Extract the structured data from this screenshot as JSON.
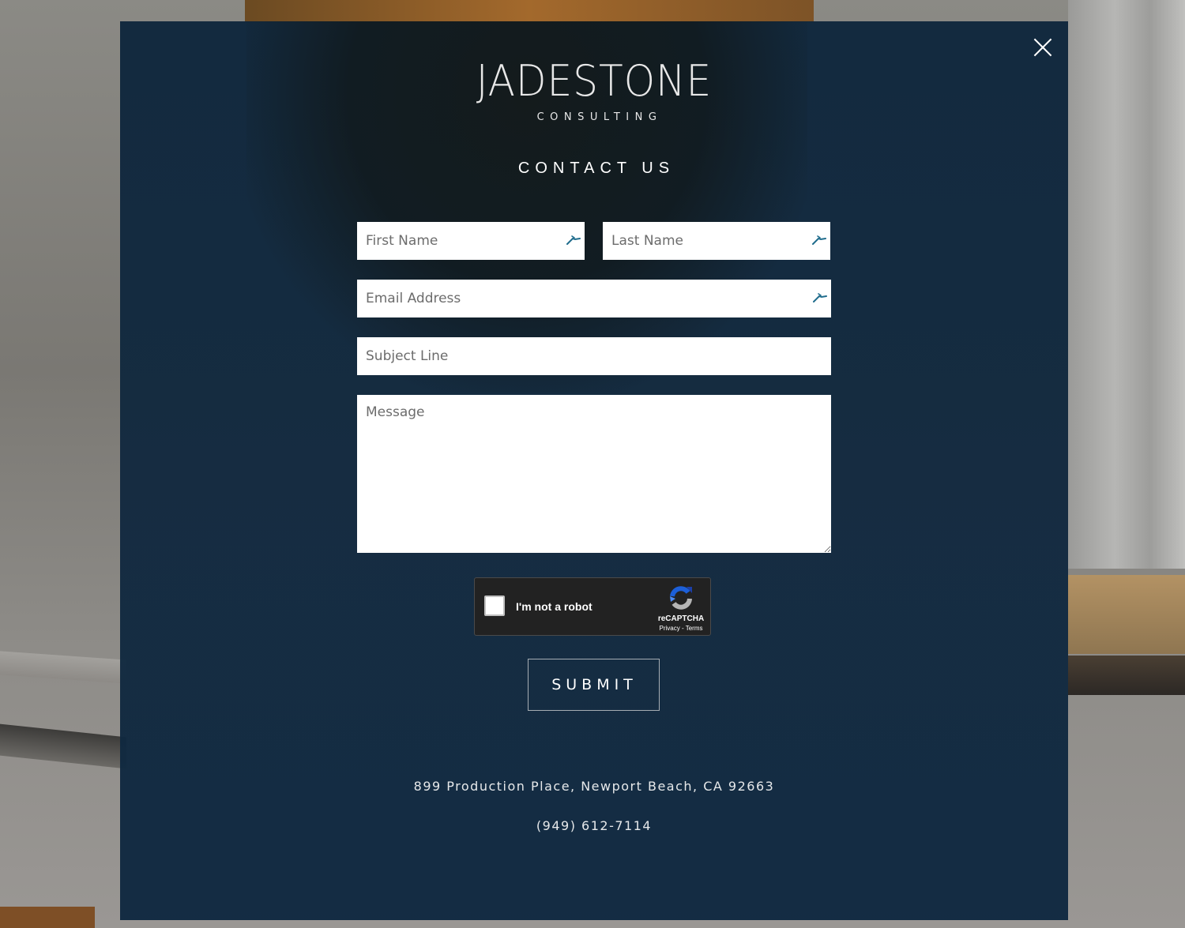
{
  "modal": {
    "close_icon": "close-icon",
    "logo": {
      "name": "JADESTONE",
      "tagline": "CONSULTING"
    },
    "heading": "CONTACT US",
    "form": {
      "first_name": {
        "value": "",
        "placeholder": "First Name",
        "icon": "autofill-icon"
      },
      "last_name": {
        "value": "",
        "placeholder": "Last Name",
        "icon": "autofill-icon"
      },
      "email": {
        "value": "",
        "placeholder": "Email Address",
        "icon": "autofill-icon"
      },
      "subject": {
        "value": "",
        "placeholder": "Subject Line"
      },
      "message": {
        "value": "",
        "placeholder": "Message"
      },
      "captcha": {
        "label": "I'm not a robot",
        "brand": "reCAPTCHA",
        "links": "Privacy - Terms",
        "checked": false
      },
      "submit_label": "SUBMIT"
    },
    "address": "899 Production Place, Newport Beach, CA 92663",
    "phone": "(949) 612-7114"
  },
  "colors": {
    "overlay": "#0f2740",
    "text": "#ffffff",
    "autofill_icon": "#1f6c8c",
    "captcha_bg": "#222222"
  }
}
